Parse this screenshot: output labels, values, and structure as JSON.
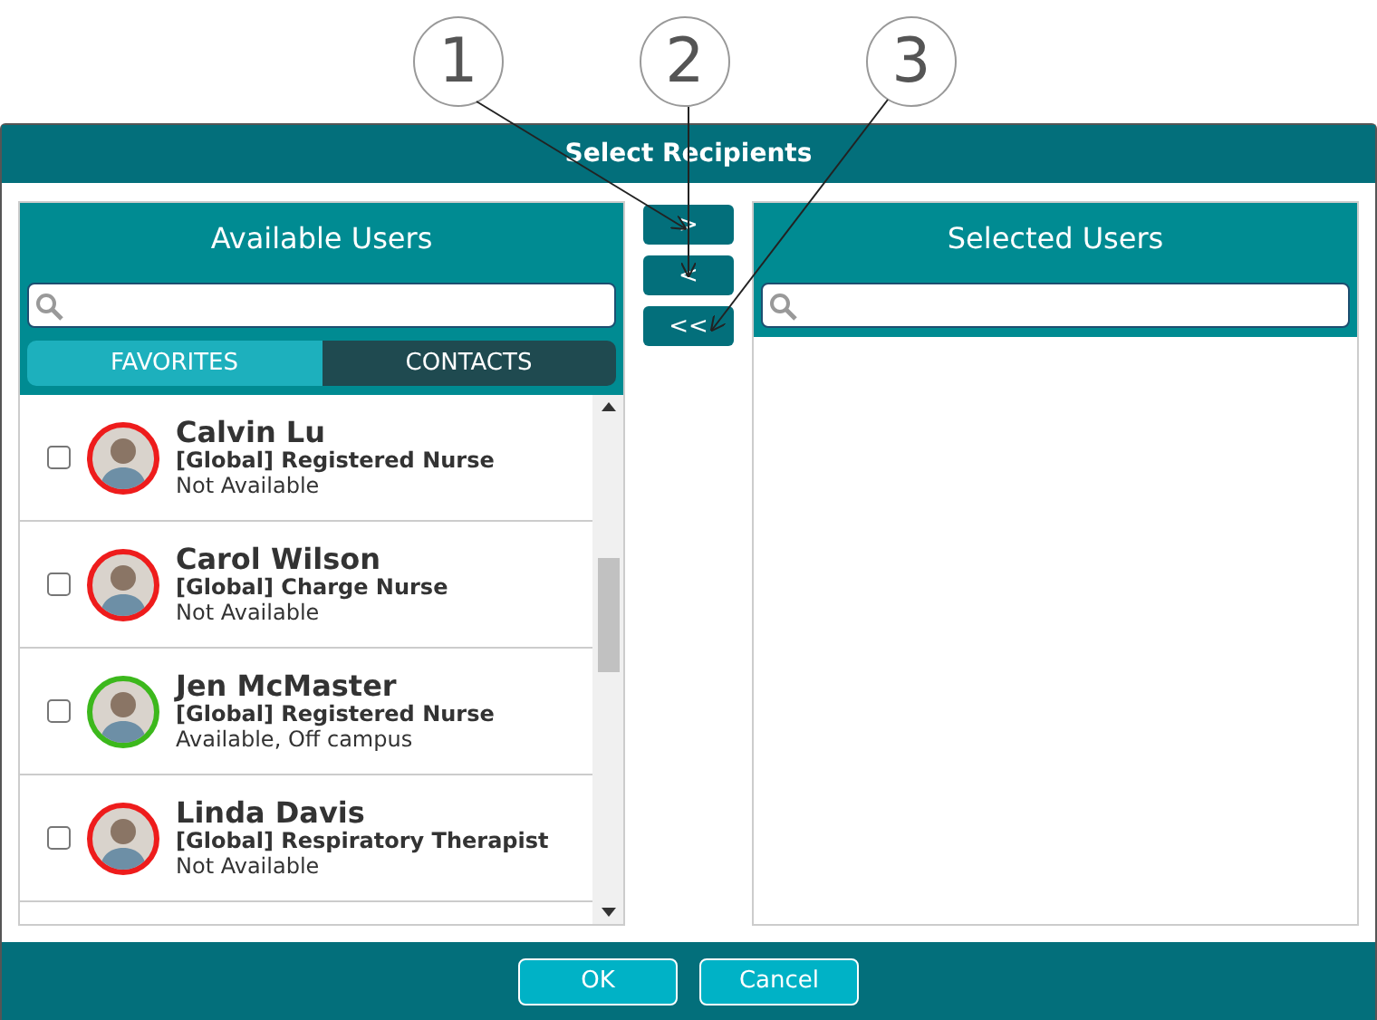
{
  "callouts": [
    "1",
    "2",
    "3"
  ],
  "window": {
    "title": "Select Recipients"
  },
  "available": {
    "title": "Available Users",
    "tabs": [
      {
        "label": "FAVORITES",
        "selected": true
      },
      {
        "label": "CONTACTS",
        "selected": false
      }
    ],
    "users": [
      {
        "name": "Calvin Lu",
        "role": "[Global] Registered Nurse",
        "status": "Not Available",
        "color": "#ee1c1c",
        "checked": false
      },
      {
        "name": "Carol Wilson",
        "role": "[Global] Charge Nurse",
        "status": "Not Available",
        "color": "#ee1c1c",
        "checked": false
      },
      {
        "name": "Jen McMaster",
        "role": "[Global] Registered Nurse",
        "status": "Available, Off campus",
        "color": "#3cb81c",
        "checked": false
      },
      {
        "name": "Linda Davis",
        "role": "[Global] Respiratory Therapist",
        "status": "Not Available",
        "color": "#ee1c1c",
        "checked": false
      }
    ]
  },
  "move_buttons": [
    ">",
    "<",
    "<<"
  ],
  "selected": {
    "title": "Selected Users"
  },
  "buttons": [
    "OK",
    "Cancel"
  ]
}
